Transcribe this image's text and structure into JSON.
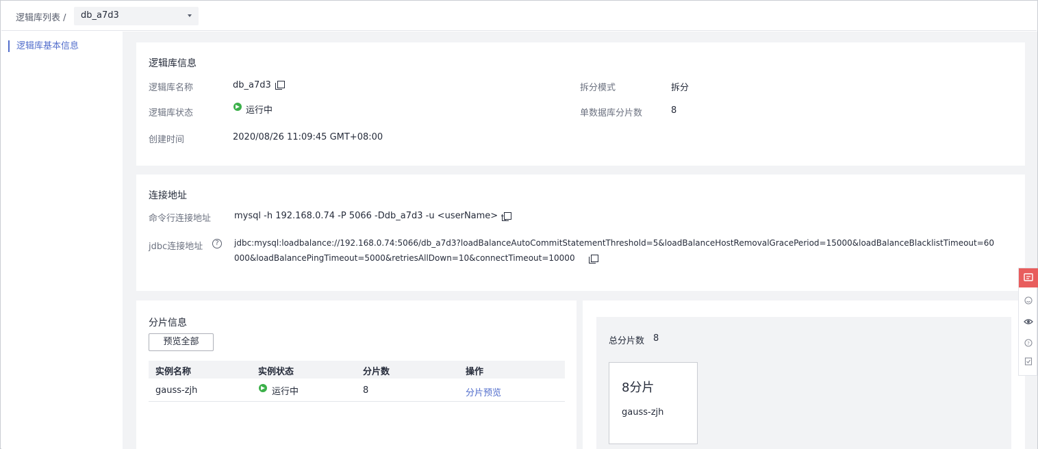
{
  "breadcrumb": {
    "parent": "逻辑库列表 /",
    "selected_db": "db_a7d3"
  },
  "sidebar": {
    "items": [
      {
        "label": "逻辑库基本信息"
      }
    ]
  },
  "db_info": {
    "title": "逻辑库信息",
    "name_label": "逻辑库名称",
    "name_value": "db_a7d3",
    "status_label": "逻辑库状态",
    "status_value": "运行中",
    "created_label": "创建时间",
    "created_value": "2020/08/26 11:09:45 GMT+08:00",
    "split_mode_label": "拆分模式",
    "split_mode_value": "拆分",
    "shards_per_db_label": "单数据库分片数",
    "shards_per_db_value": "8"
  },
  "connection": {
    "title": "连接地址",
    "cli_label": "命令行连接地址",
    "cli_value": "mysql -h 192.168.0.74 -P 5066 -Ddb_a7d3 -u <userName> -p",
    "jdbc_label": "jdbc连接地址",
    "jdbc_line1": "jdbc:mysql:loadbalance://192.168.0.74:5066/db_a7d3?loadBalanceAutoCommitStatementThreshold=5&loadBalanceHostRemovalGracePeriod=15000&loadBalanceBlacklistTimeout=60",
    "jdbc_line2": "000&loadBalancePingTimeout=5000&retriesAllDown=10&connectTimeout=10000"
  },
  "shard_info": {
    "title": "分片信息",
    "preview_all_label": "预览全部",
    "columns": [
      "实例名称",
      "实例状态",
      "分片数",
      "操作"
    ],
    "rows": [
      {
        "instance": "gauss-zjh",
        "status": "运行中",
        "shards": "8",
        "action": "分片预览"
      }
    ]
  },
  "shard_summary": {
    "total_label": "总分片数",
    "total_value": "8",
    "box_title": "8分片",
    "box_instance": "gauss-zjh"
  },
  "colors": {
    "accent": "#526ecc",
    "running": "#3cb04a",
    "feedback": "#e85d5d"
  },
  "float_toolbar": {
    "icons": [
      "feedback-icon",
      "smile-icon",
      "eye-icon",
      "help-icon",
      "checklist-icon"
    ]
  }
}
